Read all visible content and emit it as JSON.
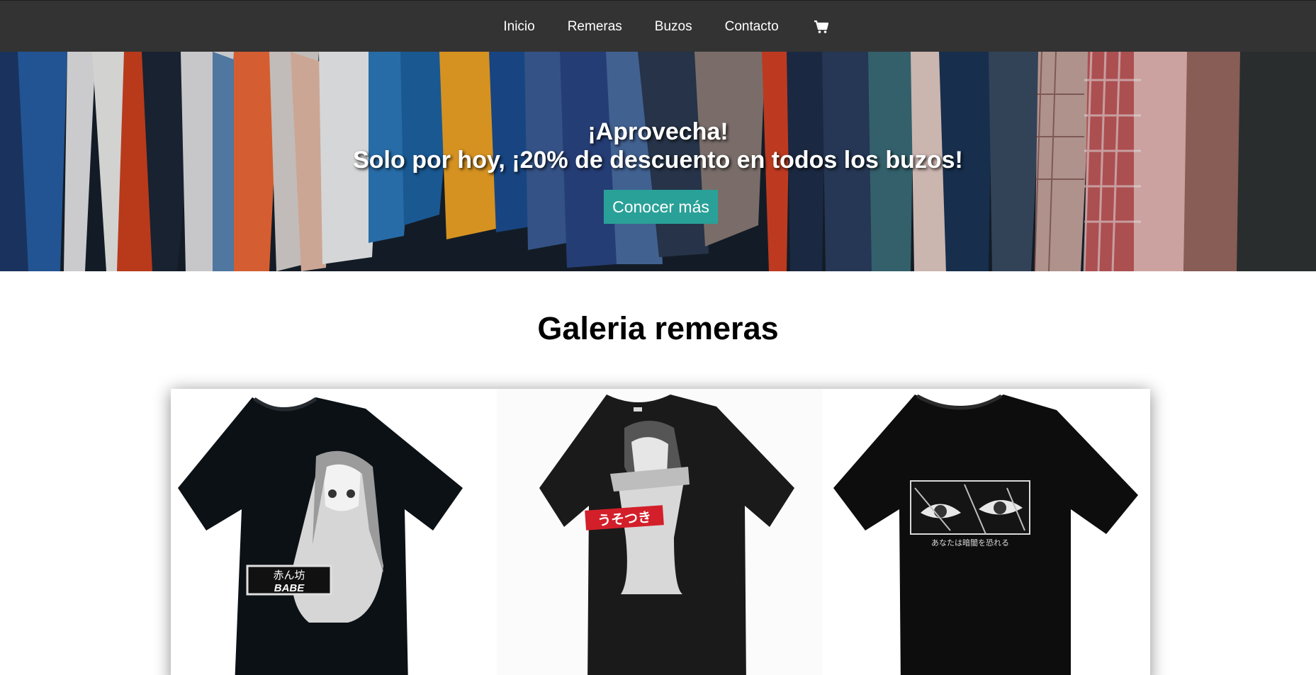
{
  "nav": {
    "items": [
      {
        "label": "Inicio"
      },
      {
        "label": "Remeras"
      },
      {
        "label": "Buzos"
      },
      {
        "label": "Contacto"
      }
    ],
    "cart_icon": "shopping-cart-icon"
  },
  "hero": {
    "line1": "¡Aprovecha!",
    "line2": "Solo por hoy, ¡20% de descuento en todos los buzos!",
    "button_label": "Conocer más",
    "button_color": "#2aa198"
  },
  "gallery": {
    "title": "Galeria remeras",
    "products": [
      {
        "print_label_jp": "赤ん坊",
        "print_label_en": "BABE"
      },
      {
        "print_label_jp": "うそつき"
      },
      {
        "print_label_jp": "あなたは暗闇を恐れる"
      }
    ]
  },
  "colors": {
    "navbar": "#333333",
    "accent": "#2aa198"
  }
}
